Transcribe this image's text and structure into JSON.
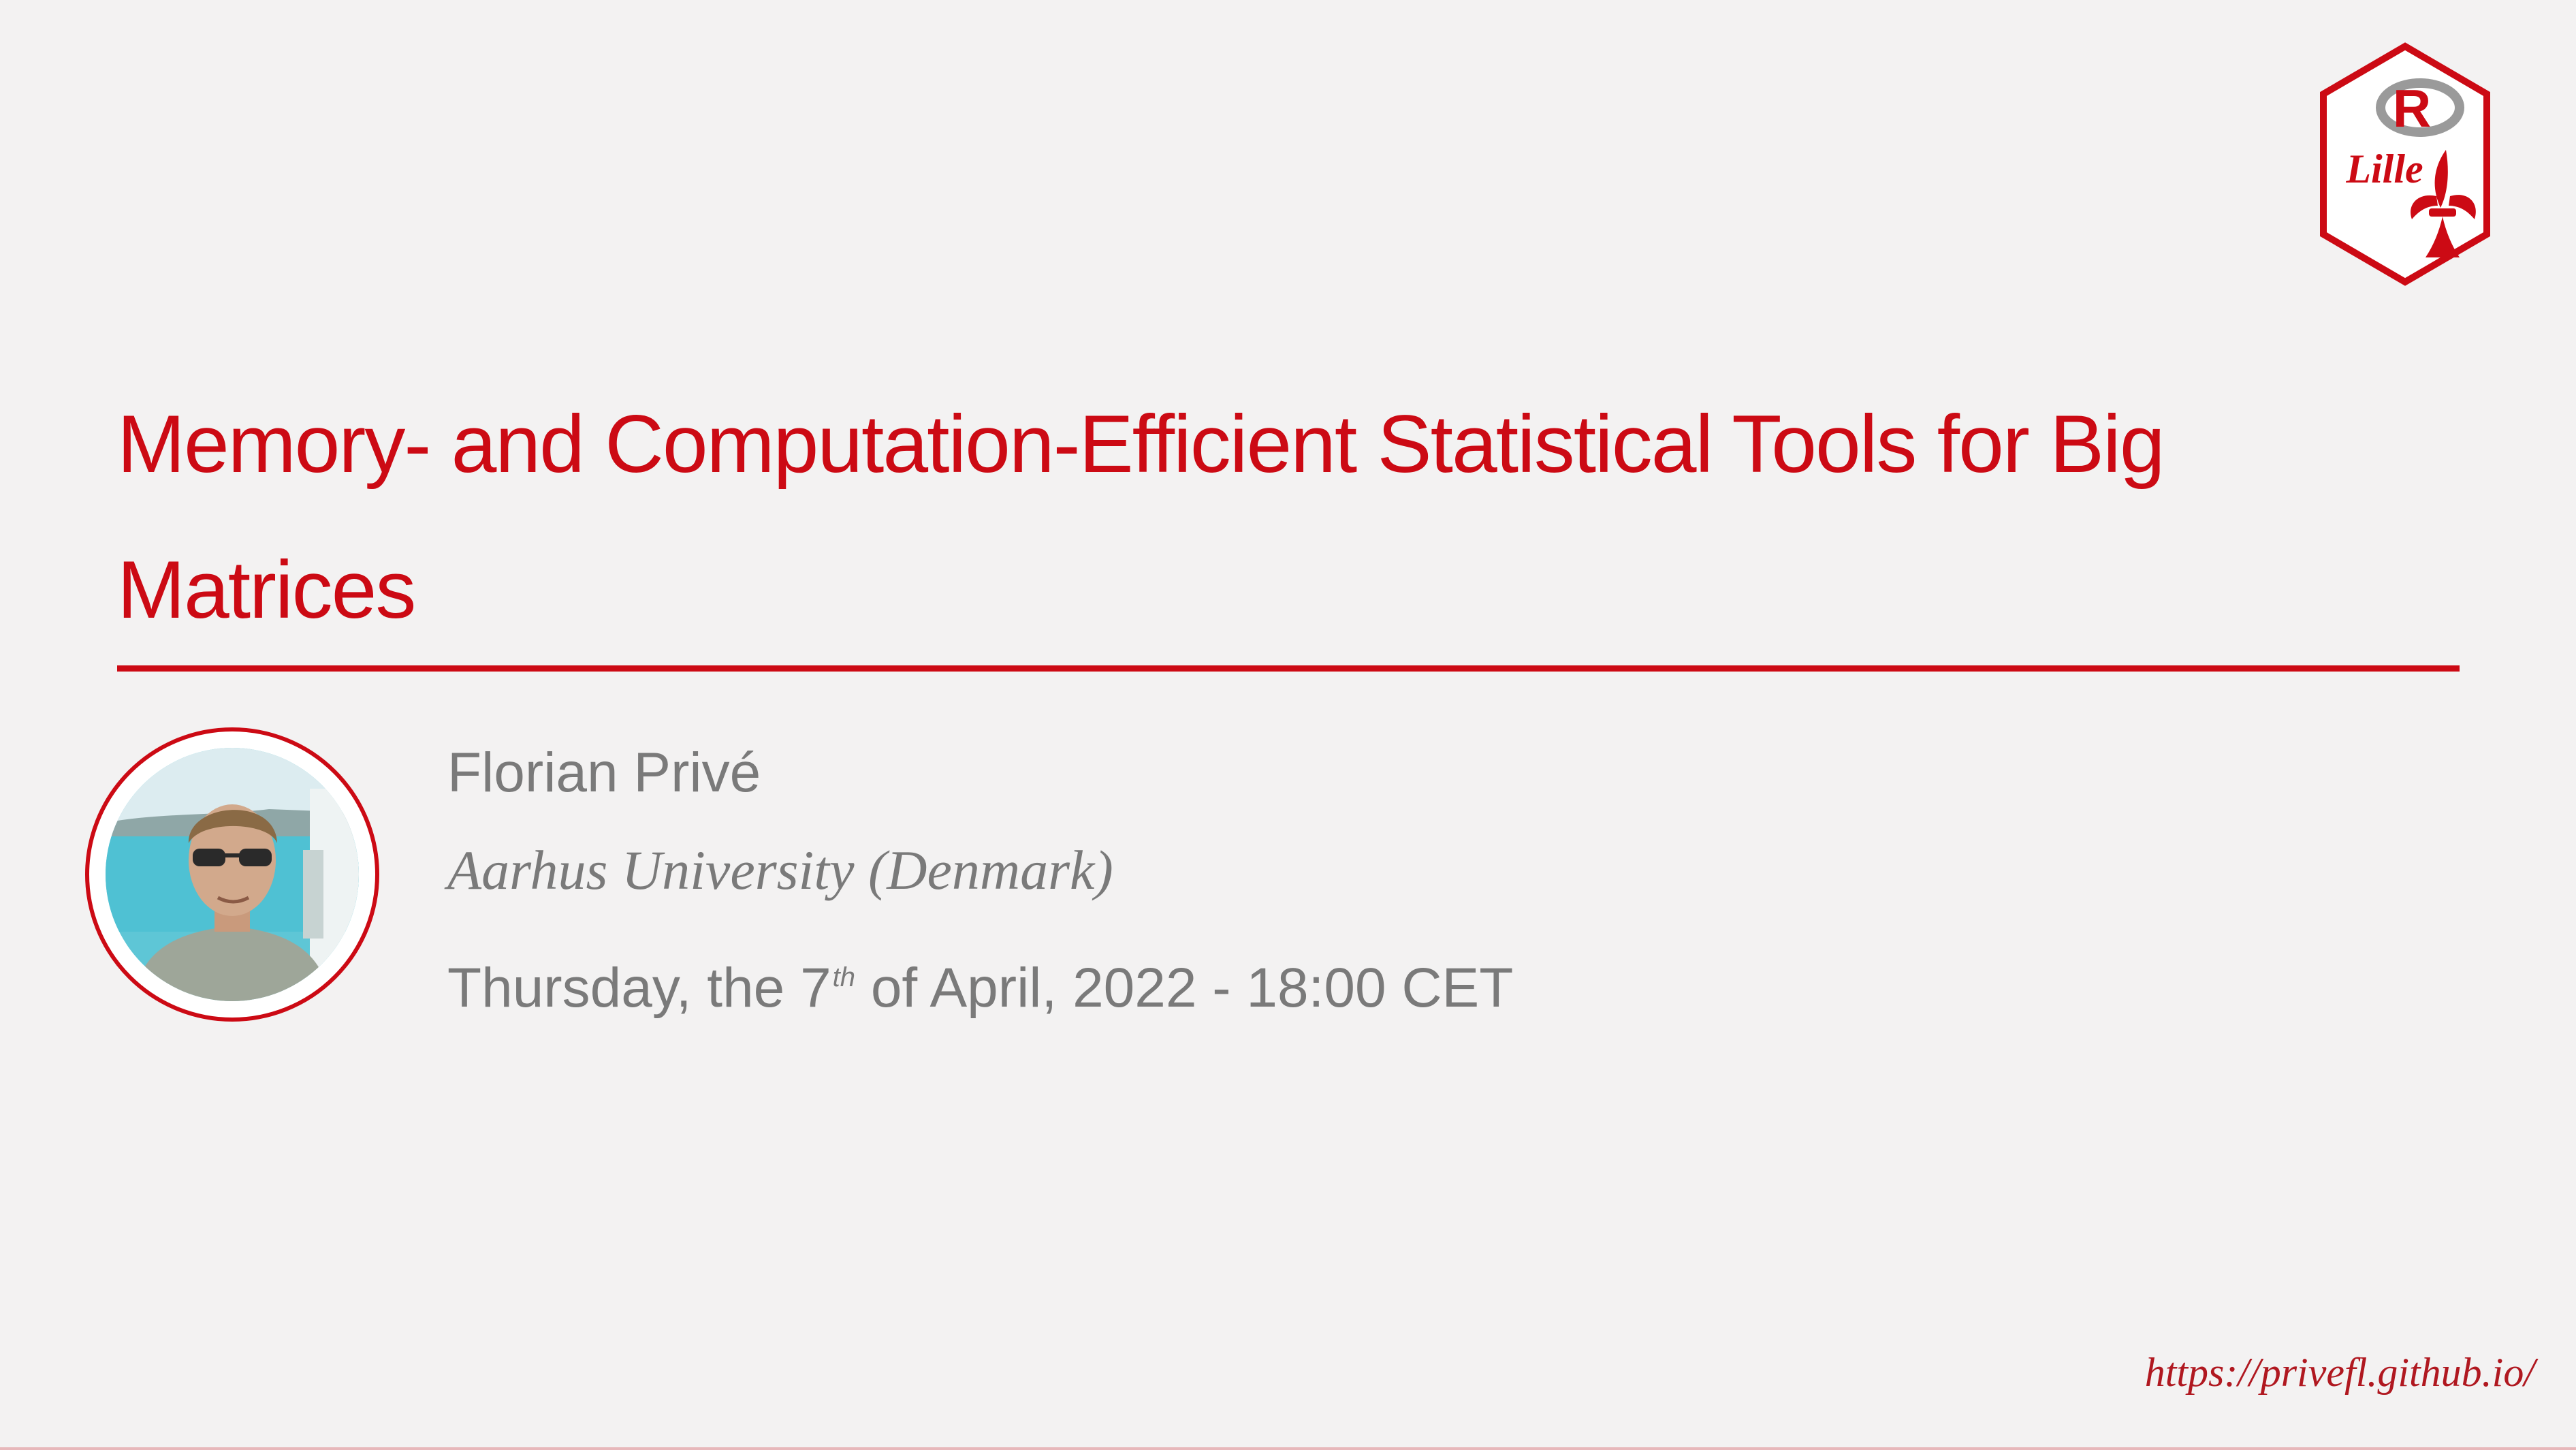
{
  "slide": {
    "title": "Memory- and Computation-Efficient Statistical Tools for Big Matrices",
    "author": "Florian Privé",
    "institute": "Aarhus University (Denmark)",
    "date_prefix": "Thursday, the 7",
    "date_superscript": "th",
    "date_suffix": " of April, 2022 - 18:00 CET",
    "url": "https://privefl.github.io/"
  },
  "logo": {
    "letter": "R",
    "city": "Lille"
  },
  "colors": {
    "accent": "#cc0a14",
    "text_muted": "#7a7a7a",
    "background": "#f3f2f2"
  }
}
